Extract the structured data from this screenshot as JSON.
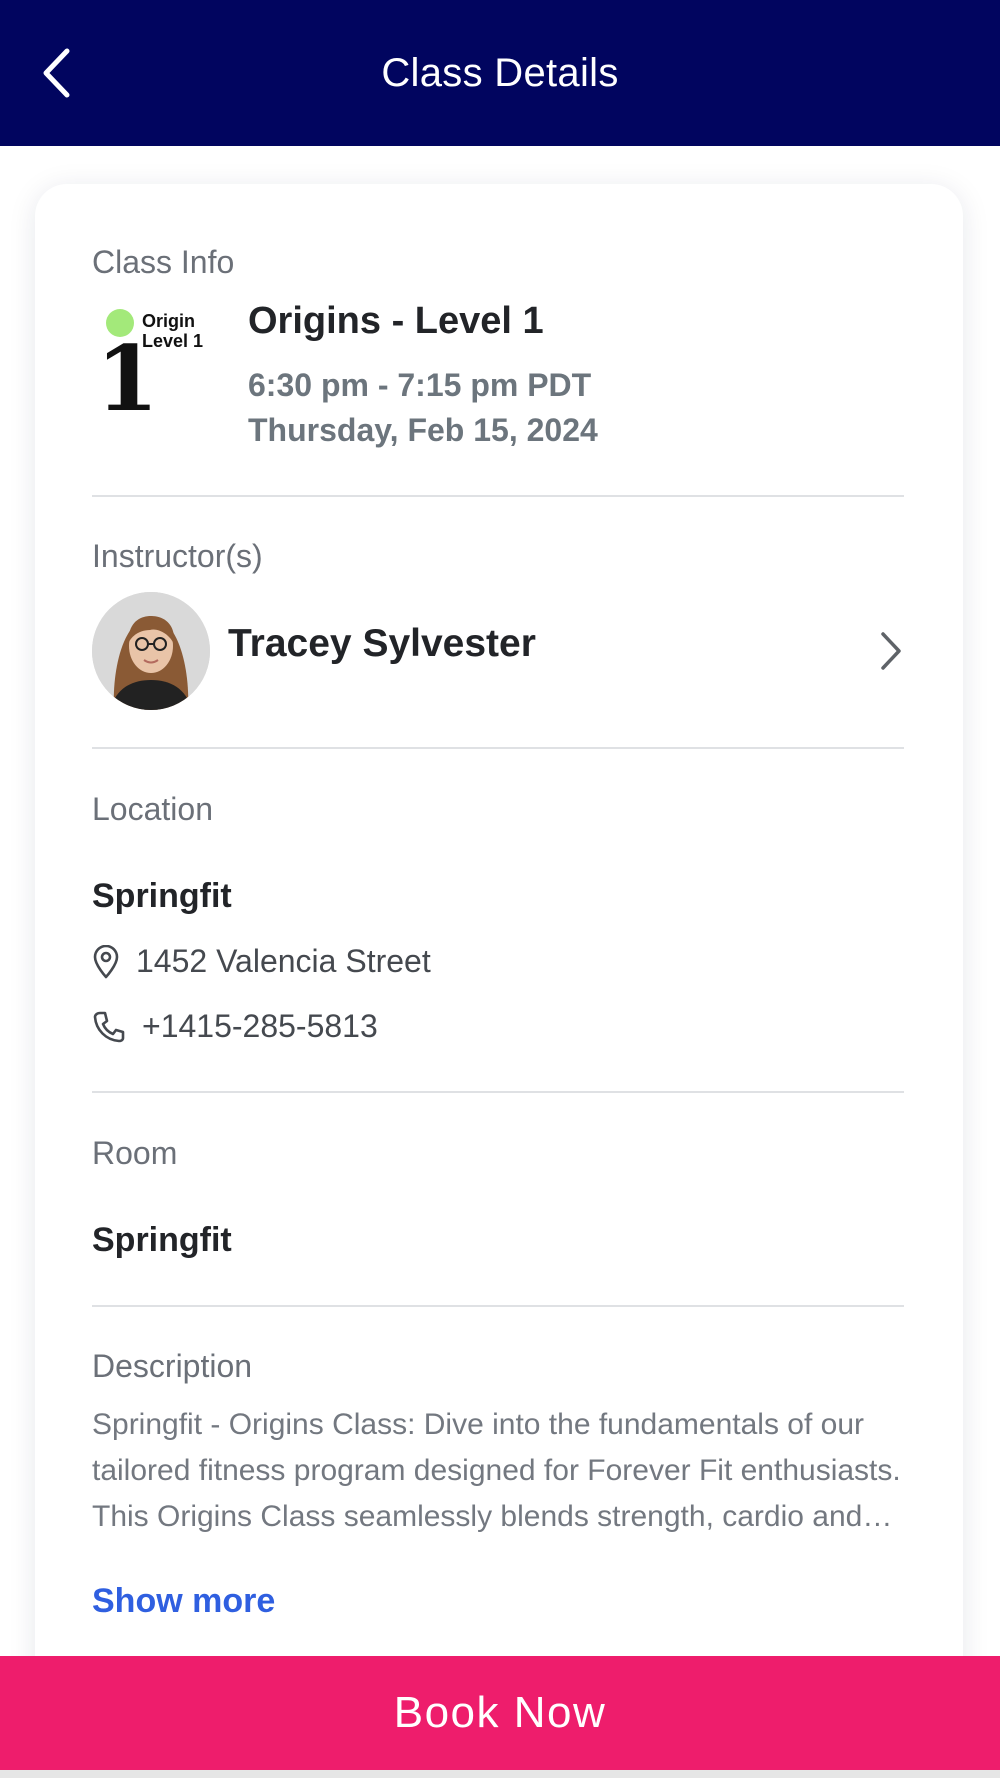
{
  "header": {
    "title": "Class Details"
  },
  "class_info": {
    "label": "Class Info",
    "logo_text_line1": "Origin",
    "logo_text_line2": "Level 1",
    "logo_numeral": "1",
    "name": "Origins - Level 1",
    "time": "6:30 pm - 7:15 pm PDT",
    "date": "Thursday, Feb 15, 2024"
  },
  "instructors": {
    "label": "Instructor(s)",
    "items": [
      {
        "name": "Tracey Sylvester"
      }
    ]
  },
  "location": {
    "label": "Location",
    "name": "Springfit",
    "address": "1452 Valencia Street",
    "phone": "+1415-285-5813"
  },
  "room": {
    "label": "Room",
    "name": "Springfit"
  },
  "description": {
    "label": "Description",
    "text": "Springfit - Origins Class: Dive into the fundamentals of our tailored fitness program designed for Forever Fit enthusiasts. This Origins Class seamlessly blends strength, cardio and mobility work to build a solid foundation.",
    "show_more_label": "Show more"
  },
  "actions": {
    "book_label": "Book Now"
  },
  "colors": {
    "header_bg": "#01055f",
    "book_button": "#ee1d6c",
    "link": "#2f5fe0",
    "logo_dot": "#a3e97a"
  }
}
